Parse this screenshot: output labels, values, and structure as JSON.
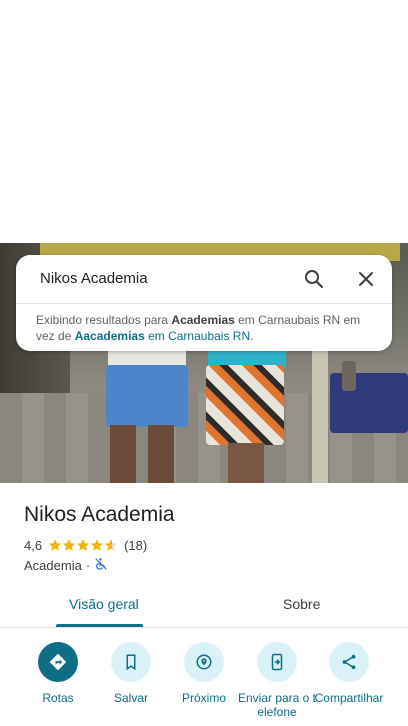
{
  "search": {
    "query": "Nikos Academia",
    "notice_prefix": "Exibindo resultados para ",
    "notice_bold": "Academias",
    "notice_middle": " em Carnaubais RN em vez de ",
    "notice_link_bold": "Aacademias",
    "notice_link_rest": " em Carnaubais RN",
    "notice_end": "."
  },
  "place": {
    "title": "Nikos Academia",
    "rating": "4,6",
    "stars": 4.6,
    "review_count": "(18)",
    "category": "Academia",
    "category_separator": "·"
  },
  "tabs": [
    {
      "label": "Visão geral",
      "selected": true
    },
    {
      "label": "Sobre",
      "selected": false
    }
  ],
  "actions": [
    {
      "label": "Rotas",
      "icon": "directions-icon"
    },
    {
      "label": "Salvar",
      "icon": "bookmark-icon"
    },
    {
      "label": "Próximo",
      "icon": "nearby-icon"
    },
    {
      "label": "Enviar para o telefone",
      "icon": "send-to-phone-icon"
    },
    {
      "label": "Compartilhar",
      "icon": "share-icon"
    }
  ],
  "colors": {
    "accent": "#0e6e85",
    "accent_light": "#d9f1f7",
    "star": "#f4b400"
  }
}
